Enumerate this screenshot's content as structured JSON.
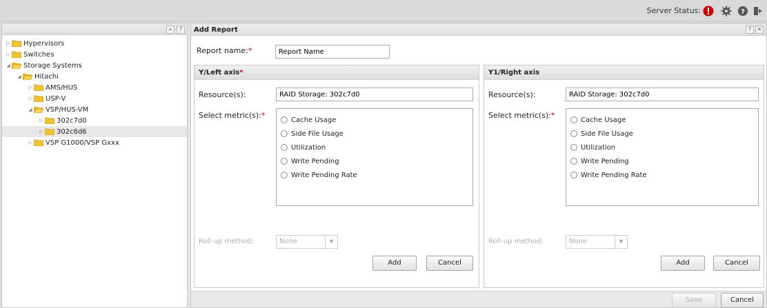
{
  "topbar": {
    "server_status_label": "Server Status:"
  },
  "tree": {
    "items": [
      {
        "label": "Hypervisors"
      },
      {
        "label": "Switches"
      },
      {
        "label": "Storage Systems"
      },
      {
        "label": "Hitachi"
      },
      {
        "label": "AMS/HUS"
      },
      {
        "label": "USP-V"
      },
      {
        "label": "VSP/HUS-VM"
      },
      {
        "label": "302c7d0"
      },
      {
        "label": "302c6d6"
      },
      {
        "label": "VSP G1000/VSP Gxxx"
      }
    ]
  },
  "main": {
    "title": "Add Report",
    "report_name_label": "Report name:",
    "report_name_value": "Report Name"
  },
  "y_axis": {
    "title": "Y/Left axis",
    "resources_label": "Resource(s):",
    "resources_value": "RAID Storage: 302c7d0",
    "metrics_label": "Select metric(s):",
    "metrics": [
      "Cache Usage",
      "Side File Usage",
      "Utilization",
      "Write Pending",
      "Write Pending Rate"
    ],
    "rollup_label": "Roll-up method:",
    "rollup_value": "None",
    "add_label": "Add",
    "cancel_label": "Cancel"
  },
  "y1_axis": {
    "title": "Y1/Right axis",
    "resources_label": "Resource(s):",
    "resources_value": "RAID Storage: 302c7d0",
    "metrics_label": "Select metric(s):",
    "metrics": [
      "Cache Usage",
      "Side File Usage",
      "Utilization",
      "Write Pending",
      "Write Pending Rate"
    ],
    "rollup_label": "Roll-up method:",
    "rollup_value": "None",
    "add_label": "Add",
    "cancel_label": "Cancel"
  },
  "footer": {
    "save_label": "Save",
    "cancel_label": "Cancel"
  },
  "colors": {
    "alert": "#cc0000",
    "required": "#d00000",
    "folder": "#f2c230"
  }
}
